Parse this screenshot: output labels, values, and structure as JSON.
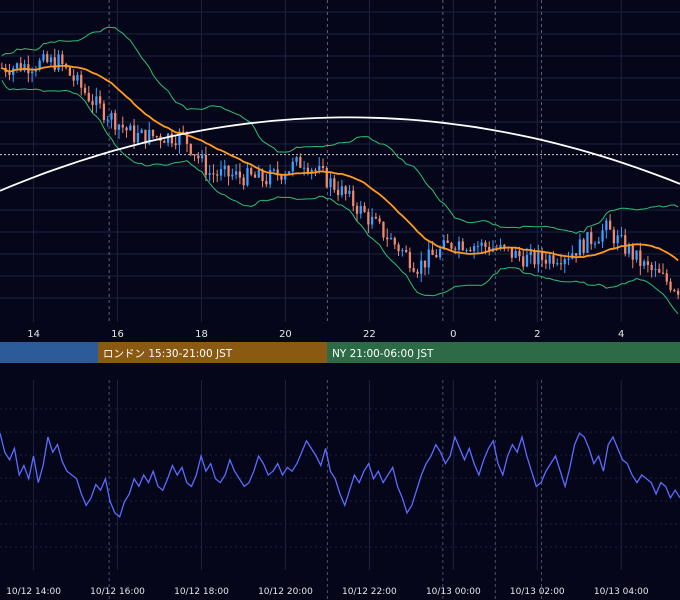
{
  "colors": {
    "background": "#05061a",
    "grid": "#1c2240",
    "candle_up": "#3da0ff",
    "candle_down": "#f08a6c",
    "moving_average": "#ff9a1f",
    "long_ma": "#ffffff",
    "bands": "#2fbf71",
    "oscillator": "#5b6cff",
    "session_tokyo": "#2c5b9a",
    "session_london": "#8a5a12",
    "session_ny": "#2c6b45"
  },
  "sessions": [
    {
      "name": "tokyo",
      "label": ""
    },
    {
      "name": "london",
      "label": "ロンドン 15:30-21:00 JST"
    },
    {
      "name": "ny",
      "label": "NY 21:00-06:00 JST"
    }
  ],
  "chart_data": [
    {
      "type": "candlestick",
      "x_unit": "hours from 10/12 00:00 JST",
      "x_ticks": [
        {
          "x": 14,
          "label": "14"
        },
        {
          "x": 16,
          "label": "16"
        },
        {
          "x": 18,
          "label": "18"
        },
        {
          "x": 20,
          "label": "20"
        },
        {
          "x": 22,
          "label": "22"
        },
        {
          "x": 24,
          "label": "0"
        },
        {
          "x": 26,
          "label": "2"
        },
        {
          "x": 28,
          "label": "4"
        }
      ],
      "xlim": [
        13.2,
        29.4
      ],
      "ylim": [
        0,
        100
      ],
      "grid": true,
      "series": [
        {
          "name": "price",
          "style": "candles"
        },
        {
          "name": "ma-short",
          "style": "line"
        },
        {
          "name": "ma-long",
          "style": "line"
        },
        {
          "name": "bb-upper",
          "style": "line"
        },
        {
          "name": "bb-lower",
          "style": "line"
        }
      ]
    },
    {
      "type": "line",
      "x_ticks": [
        {
          "x": 14,
          "label": "10/12 14:00"
        },
        {
          "x": 16,
          "label": "10/12 16:00"
        },
        {
          "x": 18,
          "label": "10/12 18:00"
        },
        {
          "x": 20,
          "label": "10/12 20:00"
        },
        {
          "x": 22,
          "label": "10/12 22:00"
        },
        {
          "x": 24,
          "label": "10/13 00:00"
        },
        {
          "x": 26,
          "label": "10/13 02:00"
        },
        {
          "x": 28,
          "label": "10/13 04:00"
        }
      ],
      "xlim": [
        13.2,
        29.4
      ],
      "ylim": [
        0,
        100
      ],
      "series": [
        {
          "name": "oscillator",
          "values": [
            72,
            62,
            58,
            64,
            50,
            55,
            48,
            60,
            46,
            55,
            70,
            62,
            66,
            57,
            52,
            50,
            48,
            40,
            34,
            38,
            45,
            42,
            48,
            36,
            30,
            28,
            36,
            40,
            48,
            44,
            50,
            46,
            52,
            44,
            42,
            48,
            55,
            50,
            54,
            46,
            44,
            50,
            60,
            52,
            56,
            48,
            46,
            50,
            58,
            52,
            48,
            44,
            46,
            52,
            60,
            56,
            50,
            52,
            56,
            50,
            54,
            52,
            56,
            62,
            68,
            64,
            60,
            55,
            64,
            52,
            48,
            40,
            34,
            42,
            50,
            46,
            52,
            56,
            48,
            52,
            46,
            50,
            54,
            44,
            38,
            30,
            34,
            42,
            50,
            56,
            60,
            66,
            62,
            56,
            60,
            70,
            64,
            58,
            64,
            56,
            50,
            58,
            64,
            68,
            56,
            50,
            60,
            66,
            62,
            70,
            60,
            52,
            44,
            46,
            52,
            56,
            60,
            52,
            44,
            54,
            66,
            72,
            70,
            64,
            56,
            60,
            52,
            66,
            70,
            64,
            58,
            56,
            50,
            46,
            50,
            48,
            46,
            40,
            46,
            44,
            38,
            42,
            38
          ]
        }
      ]
    }
  ]
}
